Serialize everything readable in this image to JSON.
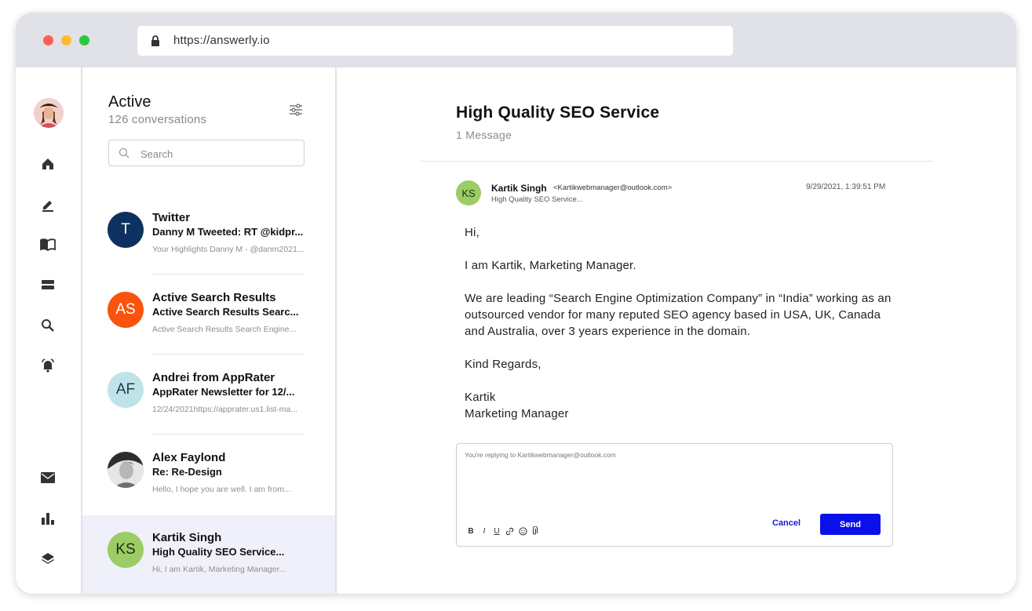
{
  "browser": {
    "url": "https://answerly.io"
  },
  "sidebar": {
    "top_icons": [
      "home-icon",
      "compose-icon",
      "book-icon",
      "storage-icon",
      "search-icon",
      "notification-icon"
    ],
    "bottom_icons": [
      "mail-icon",
      "analytics-icon",
      "layers-icon"
    ]
  },
  "conversations": {
    "title": "Active",
    "count_label": "126 conversations",
    "search_placeholder": "Search",
    "items": [
      {
        "initials": "T",
        "name": "Twitter",
        "subject": "Danny M Tweeted: RT @kidpr...",
        "preview": "Your Highlights Danny M - @danm2021...",
        "avatar_color": "#0d3261",
        "text_color": "#ffffff"
      },
      {
        "initials": "AS",
        "name": "Active Search Results",
        "subject": "Active Search Results Searc...",
        "preview": "Active Search Results Search Engine...",
        "avatar_color": "#f9540d",
        "text_color": "#ffffff"
      },
      {
        "initials": "AF",
        "name": "Andrei from AppRater",
        "subject": "AppRater Newsletter for 12/...",
        "preview": "12/24/2021https://apprater.us1.list-ma...",
        "avatar_color": "#bfe3e8",
        "text_color": "#1b3b44"
      },
      {
        "initials": "",
        "name": "Alex Faylond",
        "subject": "Re: Re-Design",
        "preview": "Hello, I hope you are well. I am from...",
        "avatar_color": "#3a3a3a",
        "text_color": "#ffffff"
      },
      {
        "initials": "KS",
        "name": "Kartik Singh",
        "subject": "High Quality SEO Service...",
        "preview": "Hi, I am Kartik, Marketing Manager...",
        "avatar_color": "#9ccc65",
        "text_color": "#1f2d12"
      }
    ]
  },
  "thread": {
    "title": "High Quality SEO Service",
    "message_count": "1 Message",
    "message": {
      "initials": "KS",
      "sender": "Kartik Singh",
      "email": "<Kartikwebmanager@outlook.com>",
      "date": "9/29/2021, 1:39:51 PM",
      "subject": "High Quality SEO Service...",
      "body": [
        "Hi,",
        "I am Kartik, Marketing Manager.",
        "We are leading “Search Engine Optimization Company” in “India” working as an outsourced vendor for many reputed SEO agency based in USA, UK, Canada and Australia, over 3 years experience in the domain.",
        "Kind Regards,",
        "Kartik",
        "Marketing Manager"
      ]
    },
    "reply": {
      "hint": "You're replying to Kartikwebmanager@outlook.com",
      "toolbar": [
        "B",
        "I",
        "U"
      ],
      "cancel_label": "Cancel",
      "send_label": "Send"
    }
  },
  "colors": {
    "accent": "#0a10e8",
    "active_row": "#f0f0fb"
  }
}
